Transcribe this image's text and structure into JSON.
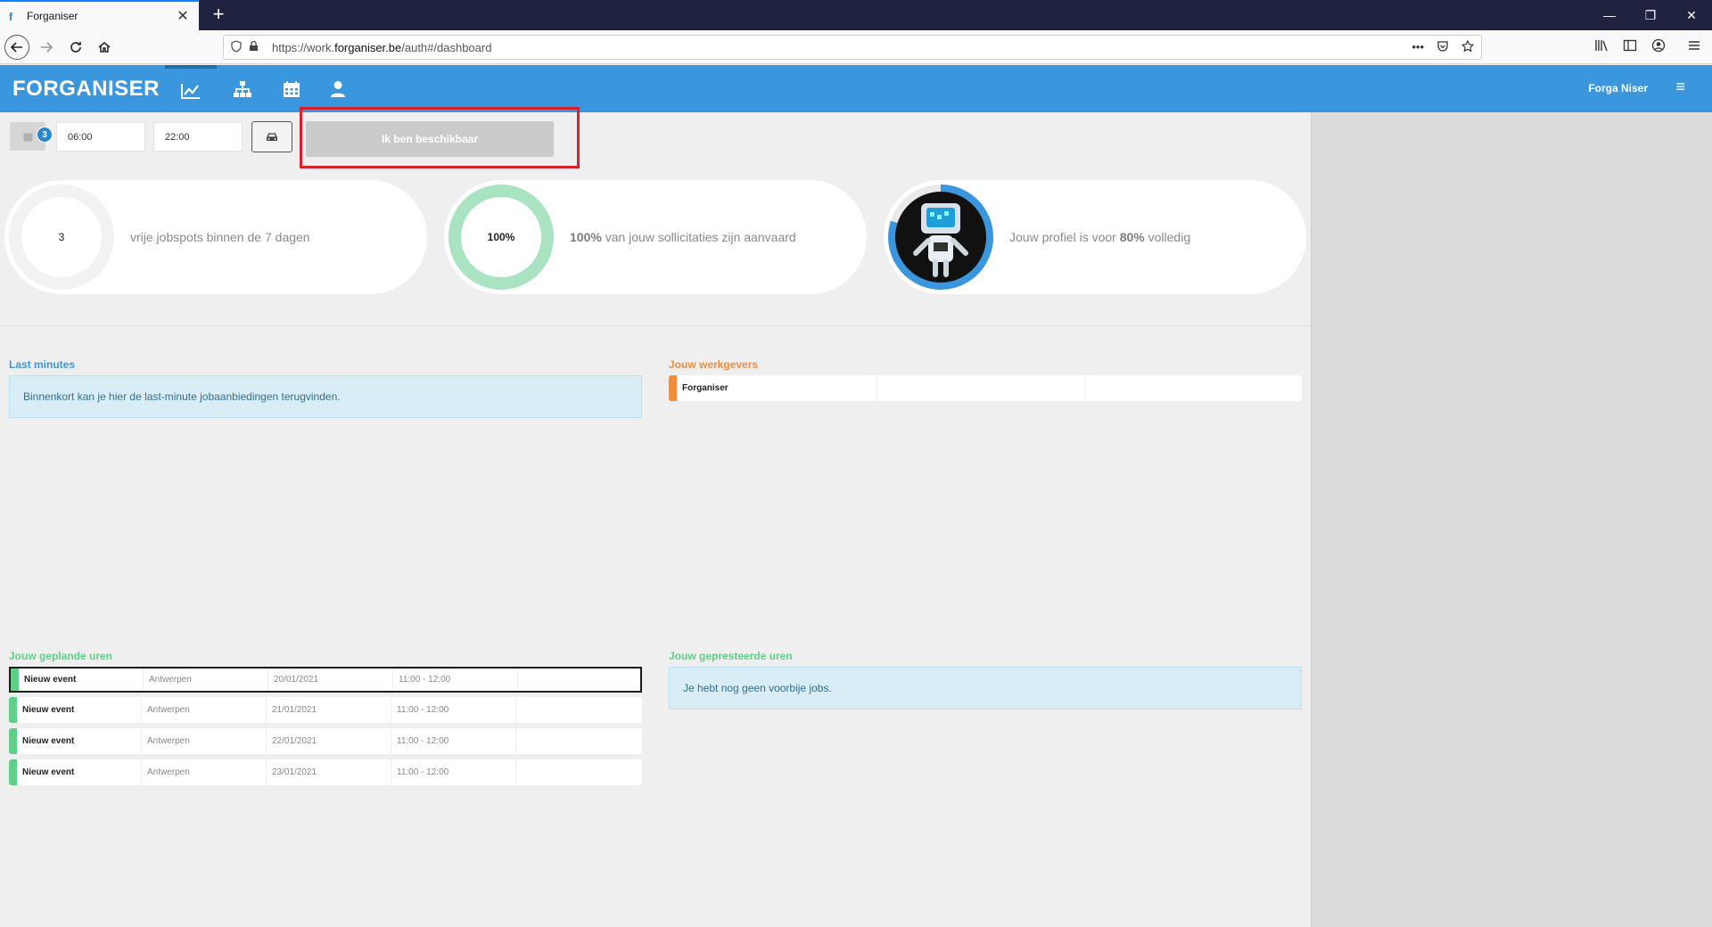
{
  "browser": {
    "tab_title": "Forganiser",
    "tab_favicon": "f",
    "close_glyph": "✕",
    "new_tab_glyph": "+",
    "url_prefix": "https://work.",
    "url_domain": "forganiser.be",
    "url_suffix": "/auth#/dashboard",
    "url_more": "•••",
    "window": {
      "minimize": "—",
      "restore": "❐",
      "close": "✕"
    }
  },
  "app": {
    "brand": "FORGANISER",
    "nav_icons": [
      "chart-icon",
      "sitemap-icon",
      "calendar-icon",
      "user-icon"
    ],
    "user_name": "Forga Niser",
    "menu_glyph": "≡"
  },
  "availability": {
    "calendar_badge": "3",
    "start_time": "06:00",
    "end_time": "22:00",
    "button_label": "Ik ben beschikbaar"
  },
  "stats": [
    {
      "value": "3",
      "text": "vrije jobspots binnen de 7 dagen",
      "ring_color": "#f2f2f2",
      "fill_fraction": 0
    },
    {
      "value": "100%",
      "text_bold": "100%",
      "text": " van jouw sollicitaties zijn aanvaard",
      "ring_color": "#a9e3c1",
      "fill_fraction": 1.0
    },
    {
      "text_prefix": "Jouw profiel is voor ",
      "text_bold": "80%",
      "text_suffix": " volledig",
      "ring_color": "#3b97dd",
      "fill_fraction": 0.8
    }
  ],
  "last_minutes": {
    "title": "Last minutes",
    "title_color": "#3b97dd",
    "message": "Binnenkort kan je hier de last-minute jobaanbiedingen terugvinden."
  },
  "employers": {
    "title": "Jouw werkgevers",
    "title_color": "#f28c3a",
    "items": [
      {
        "name": "Forganiser",
        "accent": "#f28c3a"
      }
    ]
  },
  "planned_hours": {
    "title": "Jouw geplande uren",
    "title_color": "#5fcf8a",
    "accent": "#5fcf8a",
    "rows": [
      {
        "event": "Nieuw event",
        "location": "Antwerpen",
        "date": "20/01/2021",
        "time": "11:00 - 12:00"
      },
      {
        "event": "Nieuw event",
        "location": "Antwerpen",
        "date": "21/01/2021",
        "time": "11:00 - 12:00"
      },
      {
        "event": "Nieuw event",
        "location": "Antwerpen",
        "date": "22/01/2021",
        "time": "11:00 - 12:00"
      },
      {
        "event": "Nieuw event",
        "location": "Antwerpen",
        "date": "23/01/2021",
        "time": "11:00 - 12:00"
      }
    ]
  },
  "performed_hours": {
    "title": "Jouw gepresteerde uren",
    "title_color": "#5fcf8a",
    "message": "Je hebt nog geen voorbije jobs."
  }
}
